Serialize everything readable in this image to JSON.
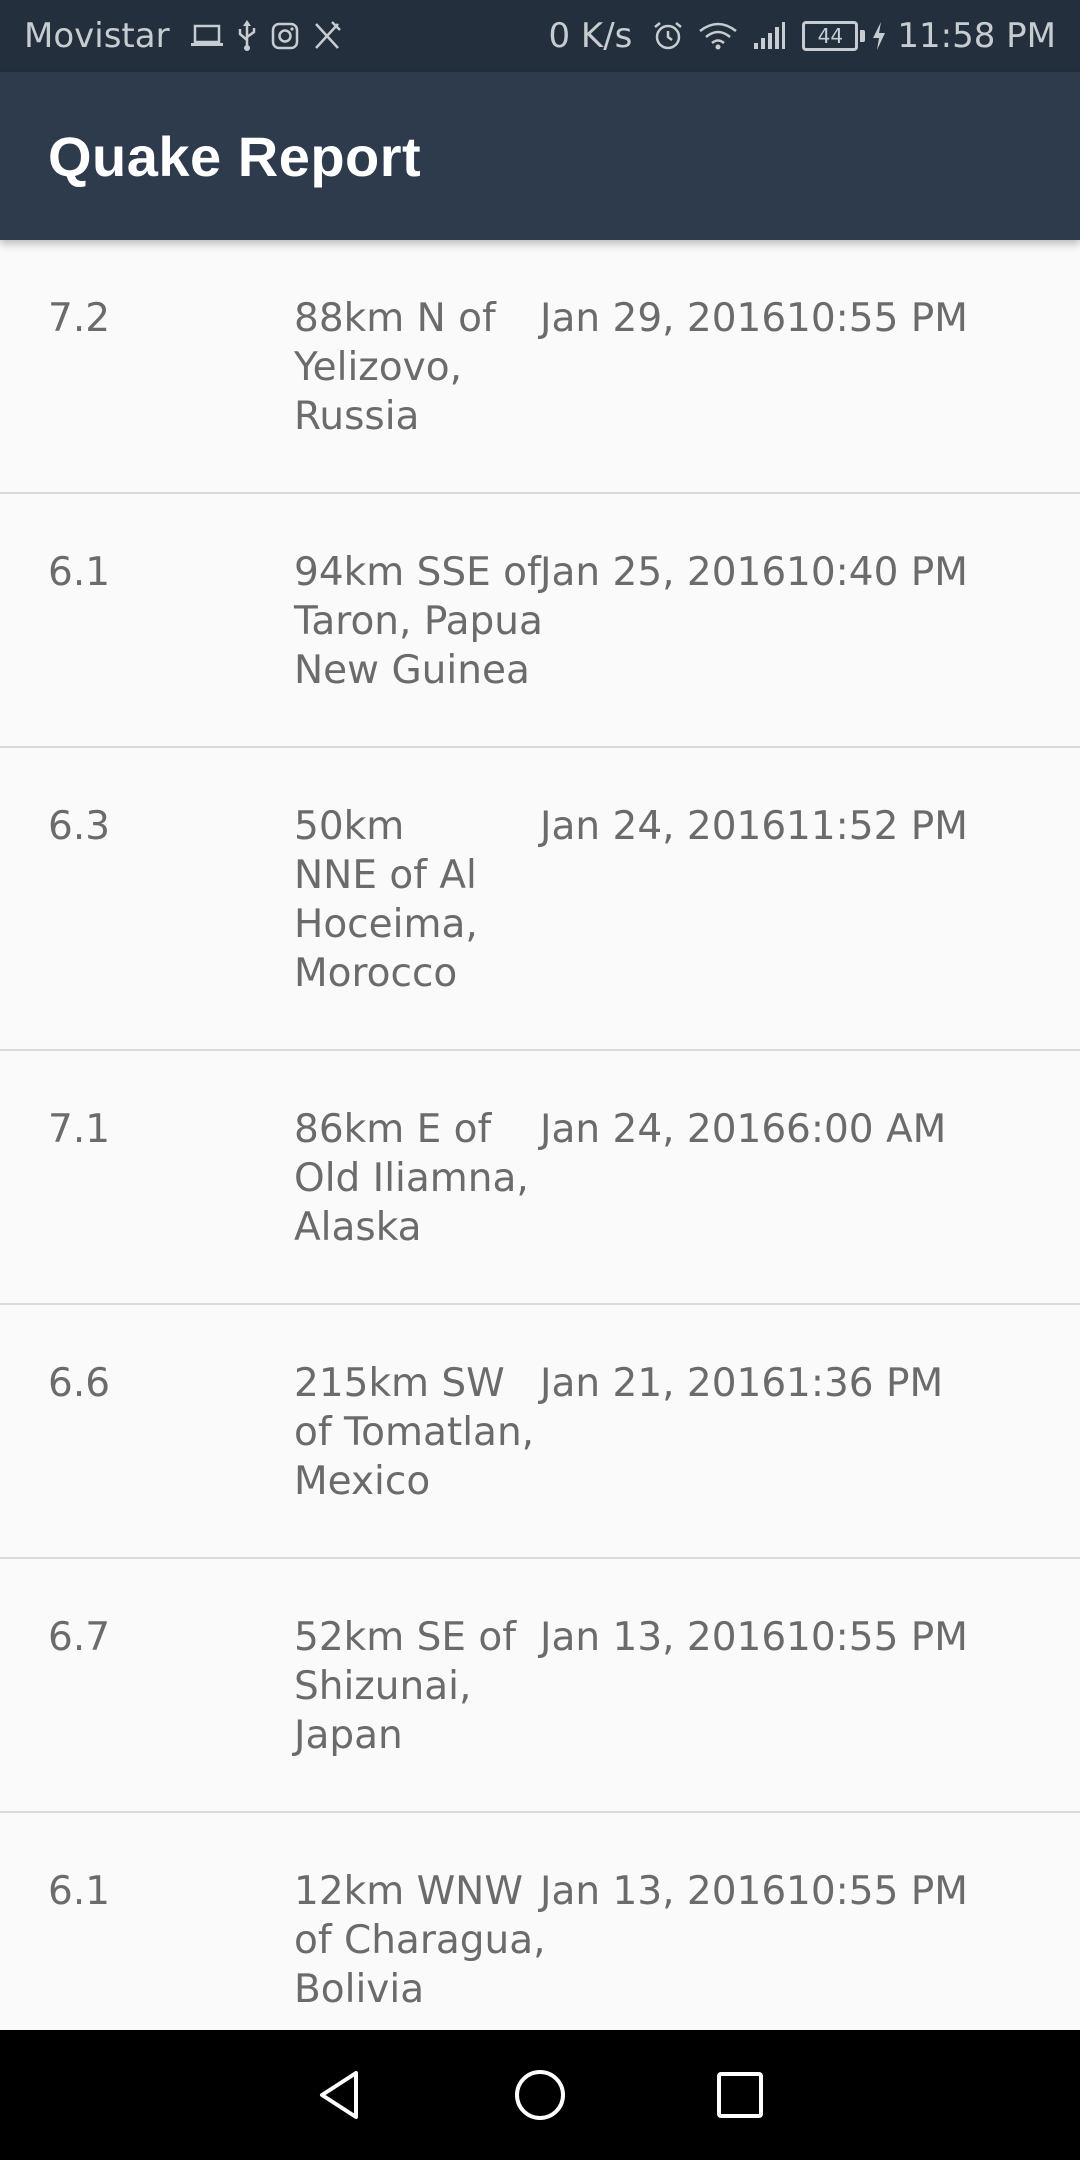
{
  "status_bar": {
    "carrier": "Movistar",
    "left_icons": [
      "laptop-icon",
      "usb-icon",
      "instagram-icon",
      "cutlery-icon"
    ],
    "net_speed": "0 K/s",
    "right_icons": [
      "alarm-icon",
      "wifi-icon",
      "signal-icon",
      "battery-icon",
      "charging-icon"
    ],
    "battery_level": "44",
    "time": "11:58 PM"
  },
  "app_bar": {
    "title": "Quake Report"
  },
  "quakes": [
    {
      "magnitude": "7.2",
      "location_lines": [
        "88km N of",
        "Yelizovo,",
        "Russia"
      ],
      "date": "Jan 29, 2016",
      "time": "10:55 PM"
    },
    {
      "magnitude": "6.1",
      "location_lines": [
        "94km SSE of",
        "Taron, Papua",
        "New Guinea"
      ],
      "date": "Jan 25, 2016",
      "time": "10:40 PM"
    },
    {
      "magnitude": "6.3",
      "location_lines": [
        "50km",
        "NNE of Al",
        "Hoceima,",
        "Morocco"
      ],
      "date": "Jan 24, 2016",
      "time": "11:52 PM"
    },
    {
      "magnitude": "7.1",
      "location_lines": [
        "86km E of",
        "Old Iliamna,",
        "Alaska"
      ],
      "date": "Jan 24, 2016",
      "time": "6:00 AM"
    },
    {
      "magnitude": "6.6",
      "location_lines": [
        "215km SW",
        "of Tomatlan,",
        "Mexico"
      ],
      "date": "Jan 21, 2016",
      "time": "1:36 PM"
    },
    {
      "magnitude": "6.7",
      "location_lines": [
        "52km SE of",
        "Shizunai,",
        "Japan"
      ],
      "date": "Jan 13, 2016",
      "time": "10:55 PM"
    },
    {
      "magnitude": "6.1",
      "location_lines": [
        "12km WNW",
        "of Charagua,",
        "Bolivia"
      ],
      "date": "Jan 13, 2016",
      "time": "10:55 PM"
    }
  ],
  "nav_bar": {
    "buttons": [
      "back-icon",
      "home-icon",
      "recents-icon"
    ]
  },
  "colors": {
    "status_bar_bg": "#232f3c",
    "app_bar_bg": "#2d3b4c",
    "list_bg": "#fafafa",
    "text": "#6b6b6b",
    "divider": "#dadada"
  }
}
